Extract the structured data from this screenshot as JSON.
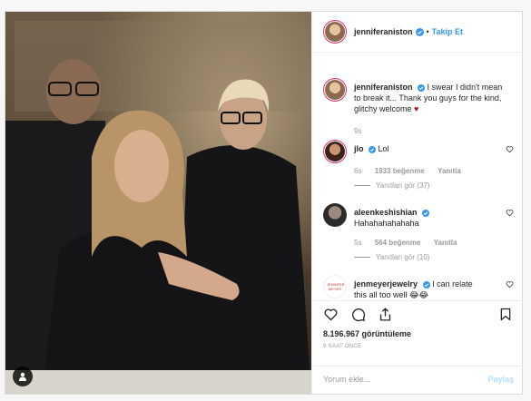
{
  "post": {
    "header": {
      "username": "jenniferaniston",
      "separator": "•",
      "follow_label": "Takip Et"
    },
    "caption": {
      "username": "jenniferaniston",
      "text": "I swear I didn't mean to break it... Thank you guys for the kind, glitchy welcome",
      "emoji": "♥",
      "time": "9s"
    },
    "comments": [
      {
        "username": "jlo",
        "text": "Lol",
        "time": "6s",
        "likes": "1933 beğenme",
        "reply_label": "Yanıtla",
        "view_replies": "Yanıtları gör (37)"
      },
      {
        "username": "aleenkeshishian",
        "text": "Hahahahahahaha",
        "time": "5s",
        "likes": "564 beğenme",
        "reply_label": "Yanıtla",
        "view_replies": "Yanıtları gör (10)"
      },
      {
        "username": "jenmeyerjewelry",
        "text": "I can relate",
        "text2": "this all too well 😂😂",
        "avatar_text": "JENNIFER MEYER"
      }
    ],
    "views": "8.196.967 görüntüleme",
    "timestamp": "9 SAAT ÖNCE",
    "add_comment_placeholder": "Yorum ekle...",
    "post_label": "Paylaş"
  },
  "colors": {
    "link": "#3897f0",
    "heart": "#ed4956",
    "verified": "#3897f0"
  }
}
